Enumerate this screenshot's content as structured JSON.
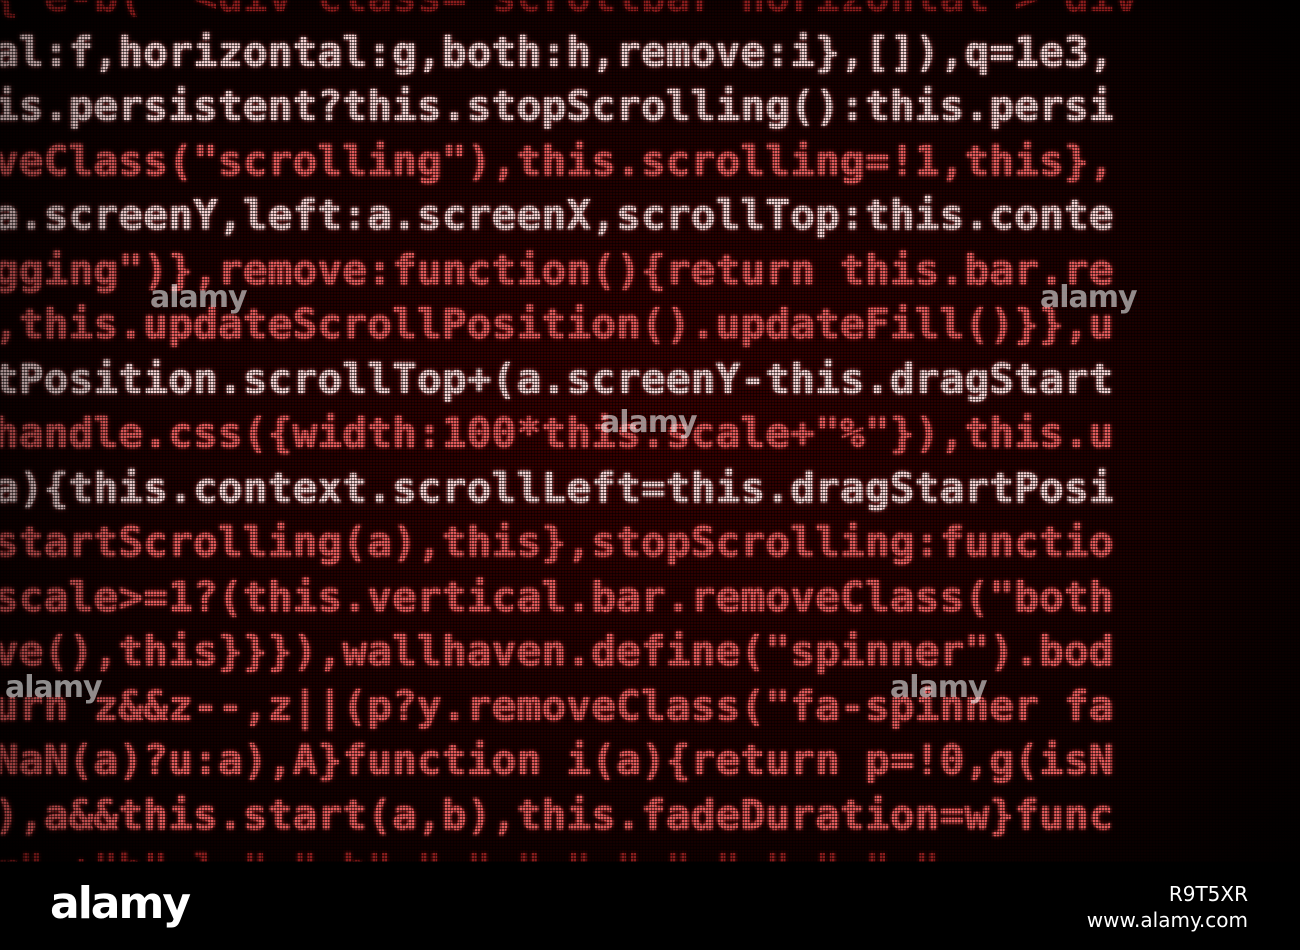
{
  "code_lines": [
    "{ e-b(' <div class= scrollbar horizontal > div",
    "al:f,horizontal:g,both:h,remove:i},[]),q=1e3,",
    "is.persistent?this.stopScrolling():this.persi",
    "veClass(\"scrolling\"),this.scrolling=!1,this},",
    "a.screenY,left:a.screenX,scrollTop:this.conte",
    "gging\")},remove:function(){return this.bar.re",
    ",this.updateScrollPosition().updateFill()}},u",
    "tPosition.scrollTop+(a.screenY-this.dragStart",
    "handle.css({width:100*this.scale+\"%\"}),this.u",
    "a){this.context.scrollLeft=this.dragStartPosi",
    "startScrolling(a),this},stopScrolling:functio",
    "scale>=1?(this.vertical.bar.removeClass(\"both",
    "ve(),this}}}),wallhaven.define(\"spinner\").bod",
    "urn z&&z--,z||(p?y.removeClass(\"fa-spinner fa",
    "NaN(a)?u:a),A}function i(a){return p=!0,g(isN",
    "),a&&this.start(a,b),this.fadeDuration=w}func",
    "r\" +\"b\" l \" \" b\" \" \" \" \" \" \" \" \" \" \" \""
  ],
  "watermark_text": "alamy",
  "footer": {
    "logo": "alamy",
    "image_id": "R9T5XR",
    "site": "www.alamy.com"
  }
}
